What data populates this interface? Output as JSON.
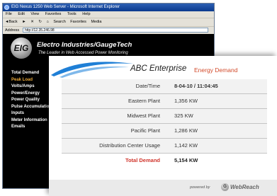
{
  "browser": {
    "title": "EIG Nexus 1250 Web Server - Microsoft Internet Explorer",
    "menu": [
      "File",
      "Edit",
      "View",
      "Favorites",
      "Tools",
      "Help"
    ],
    "toolbar": {
      "back": "◄Back",
      "forward": "►",
      "stop": "✕",
      "refresh": "↻",
      "home": "⌂",
      "search": "Search",
      "favorites": "Favorites",
      "media": "Media"
    },
    "address_label": "Address",
    "address_value": "http://12.35.246.98"
  },
  "site": {
    "logo_text": "EIG",
    "company": "Electro Industries/GaugeTech",
    "tagline": "The Leader in Web Accessed Power Monitoring"
  },
  "nav": [
    "Total Demand",
    "Peak Load",
    "Volts/Amps",
    "Power/Energy",
    "Power Quality",
    "Pulse Accumulation",
    "Inputs",
    "Meter Information",
    "Emails"
  ],
  "nav_active_index": 1,
  "panel": {
    "brand": "ABC Enterprise",
    "subtitle": "Energy Demand",
    "rows": [
      {
        "label": "Date/Time",
        "value": "8-04-10 / 11:04:45"
      },
      {
        "label": "Eastern Plant",
        "value": "1,356 KW"
      },
      {
        "label": "Midwest Plant",
        "value": "325 KW"
      },
      {
        "label": "Pacific Plant",
        "value": "1,286 KW"
      },
      {
        "label": "Distribution Center Usage",
        "value": "1,142 KW"
      }
    ],
    "total": {
      "label": "Total Demand",
      "value": "5,154 KW"
    },
    "footer_powered": "powered by",
    "footer_brand": "WebReach"
  },
  "colors": {
    "accent_red": "#d0342b",
    "nav_active": "#e9a83a",
    "swoosh_blue": "#1f7fd6"
  }
}
